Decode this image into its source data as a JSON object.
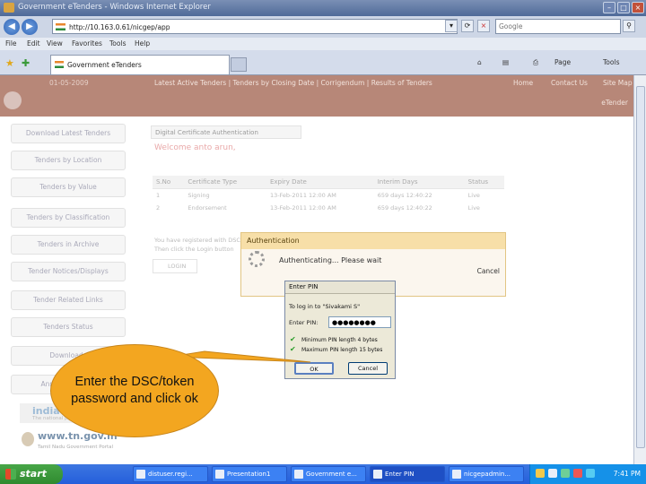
{
  "window": {
    "title": "Government eTenders - Windows Internet Explorer"
  },
  "address": {
    "url": "http://10.163.0.61/nicgep/app",
    "search_placeholder": "Google"
  },
  "menu": [
    "File",
    "Edit",
    "View",
    "Favorites",
    "Tools",
    "Help"
  ],
  "tab": {
    "label": "Government eTenders"
  },
  "commandbar": {
    "page": "Page",
    "tools": "Tools"
  },
  "banner": {
    "date": "01-05-2009",
    "nav": "Latest Active Tenders  |  Tenders by Closing Date  |  Corrigendum  |  Results of Tenders",
    "links": [
      "Home",
      "Contact Us",
      "Site Map"
    ],
    "tender_link": "eTender"
  },
  "left_menu": [
    "Download Latest Tenders",
    "Tenders by Location",
    "Tenders by Value",
    "Tenders by Classification",
    "Tenders in Archive",
    "Tender Notices/Displays",
    "Tender Related Links",
    "Tenders Status",
    "Downloads",
    "Announcements"
  ],
  "content": {
    "section_title": "Digital Certificate Authentication",
    "welcome": "Welcome anto arun,",
    "columns": [
      "S.No",
      "Certificate Type",
      "Expiry Date",
      "Interim Days",
      "Status"
    ],
    "rows": [
      [
        "1",
        "Signing",
        "13-Feb-2011 12:00 AM",
        "659 days 12:40:22",
        "Live"
      ],
      [
        "2",
        "Endorsement",
        "13-Feb-2011 12:00 AM",
        "659 days 12:40:22",
        "Live"
      ]
    ],
    "reg_line1": "You have registered with DSC. Insert the DSC card for authentication.",
    "reg_line2": "Then click the Login button",
    "login_label": "LOGIN"
  },
  "footer": {
    "logo_text": "india",
    "logo_tagline": "The national portal",
    "tn_url": "www.tn.gov.in",
    "tn_tagline": "Tamil Nadu Government Portal"
  },
  "auth_dialog": {
    "title": "Authentication",
    "message": "Authenticating... Please wait",
    "cancel": "Cancel"
  },
  "pin_dialog": {
    "title": "Enter PIN",
    "login_to": "To log in to \"Sivakami S\"",
    "pin_label": "Enter PIN:",
    "pin_value": "●●●●●●●●",
    "req_min": "Minimum PIN length 4 bytes",
    "req_max": "Maximum PIN length 15 bytes",
    "ok": "OK",
    "cancel": "Cancel"
  },
  "callout": {
    "text": "Enter the DSC/token password and click ok",
    "color": "#f3a620"
  },
  "taskbar": {
    "start": "start",
    "tasks": [
      "distuser.regi...",
      "Presentation1",
      "Government e...",
      "Enter PIN",
      "nicgepadmin..."
    ],
    "clock": "7:41 PM"
  }
}
